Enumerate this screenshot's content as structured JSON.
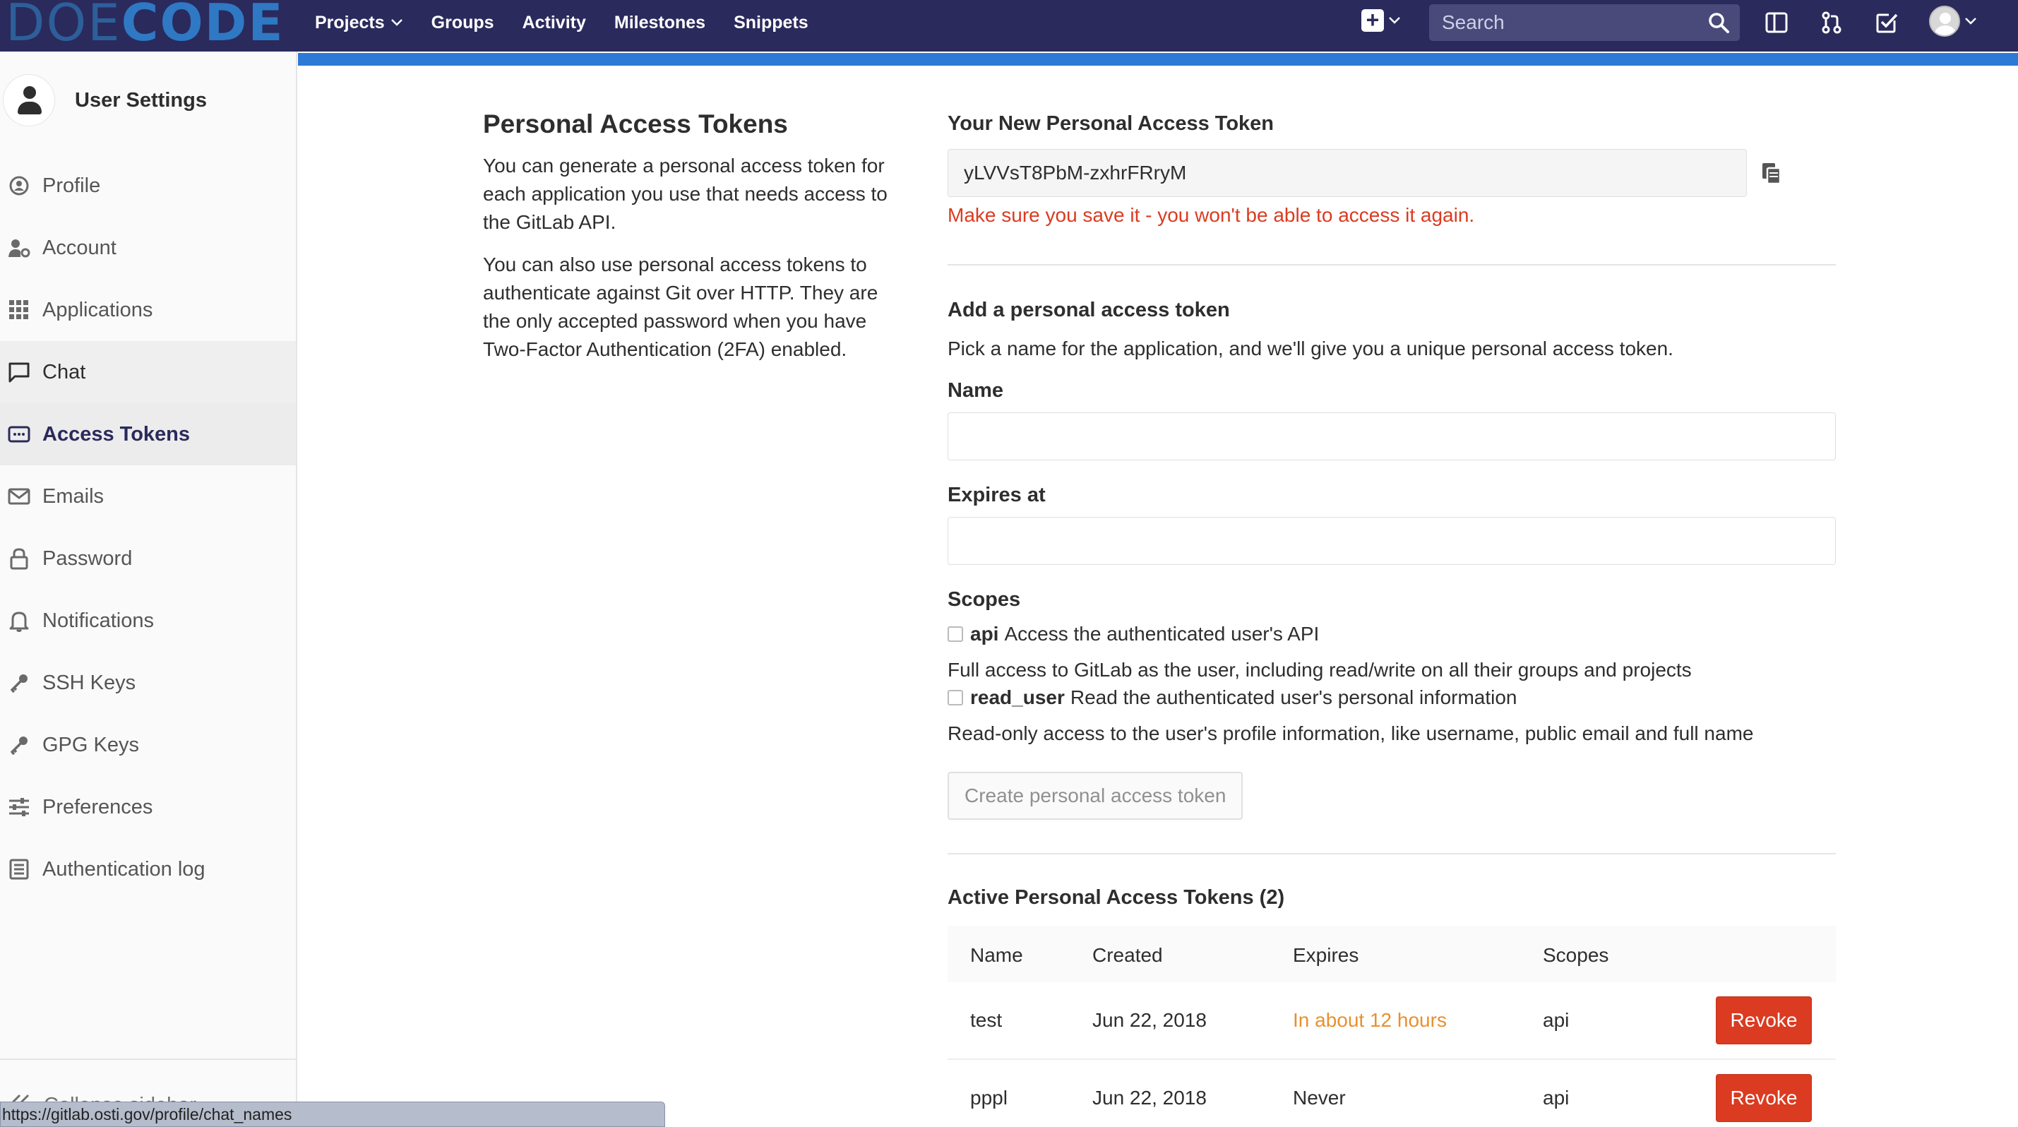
{
  "navbar": {
    "logo_light": "DOE",
    "logo_bold": "CODE",
    "links": [
      {
        "label": "Projects",
        "has_dropdown": true
      },
      {
        "label": "Groups"
      },
      {
        "label": "Activity"
      },
      {
        "label": "Milestones"
      },
      {
        "label": "Snippets"
      }
    ],
    "search_placeholder": "Search",
    "icons": [
      "plus-square-icon",
      "search-icon",
      "sidebar-toggle-icon",
      "merge-request-icon",
      "todo-check-icon",
      "user-avatar-icon"
    ],
    "bg_color": "#2b2a5c"
  },
  "sidebar": {
    "title": "User Settings",
    "items": [
      {
        "label": "Profile",
        "icon": "profile-icon"
      },
      {
        "label": "Account",
        "icon": "account-icon"
      },
      {
        "label": "Applications",
        "icon": "applications-icon"
      },
      {
        "label": "Chat",
        "icon": "chat-icon"
      },
      {
        "label": "Access Tokens",
        "icon": "access-tokens-icon",
        "active": true
      },
      {
        "label": "Emails",
        "icon": "email-icon"
      },
      {
        "label": "Password",
        "icon": "lock-icon"
      },
      {
        "label": "Notifications",
        "icon": "bell-icon"
      },
      {
        "label": "SSH Keys",
        "icon": "key-icon"
      },
      {
        "label": "GPG Keys",
        "icon": "key-icon"
      },
      {
        "label": "Preferences",
        "icon": "sliders-icon"
      },
      {
        "label": "Authentication log",
        "icon": "log-icon"
      }
    ],
    "collapse_label": "Collapse sidebar"
  },
  "status_url": "https://gitlab.osti.gov/profile/chat_names",
  "intro": {
    "title": "Personal Access Tokens",
    "para1": "You can generate a personal access token for each application you use that needs access to the GitLab API.",
    "para2": "You can also use personal access tokens to authenticate against Git over HTTP. They are the only accepted password when you have Two-Factor Authentication (2FA) enabled."
  },
  "new_token": {
    "heading": "Your New Personal Access Token",
    "value": "yLVVsT8PbM-zxhrFRryM",
    "warning": "Make sure you save it - you won't be able to access it again."
  },
  "add_form": {
    "heading": "Add a personal access token",
    "description": "Pick a name for the application, and we'll give you a unique personal access token.",
    "name_label": "Name",
    "name_value": "",
    "expires_label": "Expires at",
    "expires_value": "",
    "scopes_label": "Scopes",
    "scopes": [
      {
        "key": "api",
        "short": "Access the authenticated user's API",
        "long": "Full access to GitLab as the user, including read/write on all their groups and projects"
      },
      {
        "key": "read_user",
        "short": "Read the authenticated user's personal information",
        "long": "Read-only access to the user's profile information, like username, public email and full name"
      }
    ],
    "submit_label": "Create personal access token"
  },
  "active_tokens": {
    "heading": "Active Personal Access Tokens (2)",
    "columns": [
      "Name",
      "Created",
      "Expires",
      "Scopes"
    ],
    "rows": [
      {
        "name": "test",
        "created": "Jun 22, 2018",
        "expires": "In about 12 hours",
        "scopes": "api",
        "action": "Revoke"
      },
      {
        "name": "pppl",
        "created": "Jun 22, 2018",
        "expires": "Never",
        "scopes": "api",
        "action": "Revoke"
      }
    ]
  },
  "colors": {
    "accent": "#2d7ad6",
    "danger": "#db3b21",
    "warning_text": "#e8912e"
  }
}
